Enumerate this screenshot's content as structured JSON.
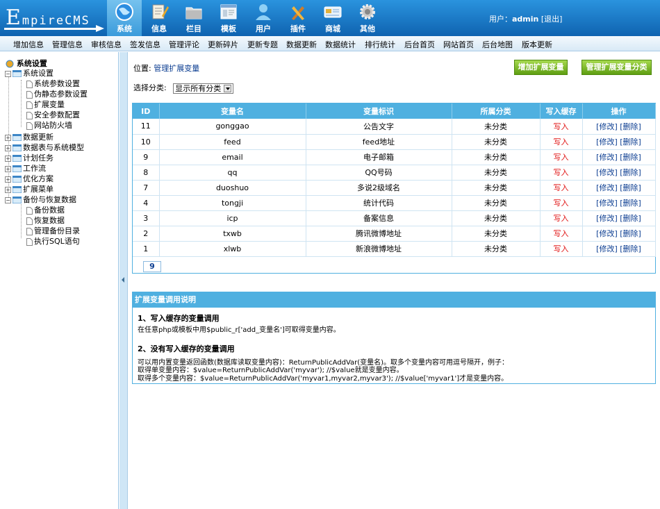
{
  "header": {
    "logo": "EmpireCMS",
    "nav_tabs": [
      {
        "label": "系统",
        "icon": "globe-icon",
        "active": true
      },
      {
        "label": "信息",
        "icon": "notepad-icon"
      },
      {
        "label": "栏目",
        "icon": "folder-icon"
      },
      {
        "label": "模板",
        "icon": "window-icon"
      },
      {
        "label": "用户",
        "icon": "user-icon"
      },
      {
        "label": "插件",
        "icon": "tools-icon"
      },
      {
        "label": "商城",
        "icon": "card-icon"
      },
      {
        "label": "其他",
        "icon": "gear-icon"
      }
    ],
    "user_prefix": "用户：",
    "user_name": "admin",
    "logout": "[退出]"
  },
  "subnav": [
    "增加信息",
    "管理信息",
    "审核信息",
    "签发信息",
    "管理评论",
    "更新碎片",
    "更新专题",
    "数据更新",
    "数据统计",
    "排行统计",
    "后台首页",
    "网站首页",
    "后台地图",
    "版本更新"
  ],
  "sidebar": {
    "root": "系统设置",
    "groups": [
      {
        "label": "系统设置",
        "expanded": true,
        "children": [
          "系统参数设置",
          "伪静态参数设置",
          "扩展变量",
          "安全参数配置",
          "网站防火墙"
        ]
      },
      {
        "label": "数据更新"
      },
      {
        "label": "数据表与系统模型"
      },
      {
        "label": "计划任务"
      },
      {
        "label": "工作流"
      },
      {
        "label": "优化方案"
      },
      {
        "label": "扩展菜单"
      },
      {
        "label": "备份与恢复数据",
        "expanded": true,
        "children": [
          "备份数据",
          "恢复数据",
          "管理备份目录",
          "执行SQL语句"
        ]
      }
    ]
  },
  "main": {
    "breadcrumb_prefix": "位置: ",
    "breadcrumb_link": "管理扩展变量",
    "btn_add": "增加扩展变量",
    "btn_manage_class": "管理扩展变量分类",
    "filter_label": "选择分类:",
    "filter_value": "显示所有分类",
    "table": {
      "headers": [
        "ID",
        "变量名",
        "变量标识",
        "所属分类",
        "写入缓存",
        "操作"
      ],
      "rows": [
        {
          "id": "11",
          "name": "gonggao",
          "label": "公告文字",
          "cls": "未分类",
          "cache": "写入",
          "edit": "[修改]",
          "del": "[删除]"
        },
        {
          "id": "10",
          "name": "feed",
          "label": "feed地址",
          "cls": "未分类",
          "cache": "写入",
          "edit": "[修改]",
          "del": "[删除]"
        },
        {
          "id": "9",
          "name": "email",
          "label": "电子邮箱",
          "cls": "未分类",
          "cache": "写入",
          "edit": "[修改]",
          "del": "[删除]"
        },
        {
          "id": "8",
          "name": "qq",
          "label": "QQ号码",
          "cls": "未分类",
          "cache": "写入",
          "edit": "[修改]",
          "del": "[删除]"
        },
        {
          "id": "7",
          "name": "duoshuo",
          "label": "多说2级域名",
          "cls": "未分类",
          "cache": "写入",
          "edit": "[修改]",
          "del": "[删除]"
        },
        {
          "id": "4",
          "name": "tongji",
          "label": "统计代码",
          "cls": "未分类",
          "cache": "写入",
          "edit": "[修改]",
          "del": "[删除]"
        },
        {
          "id": "3",
          "name": "icp",
          "label": "备案信息",
          "cls": "未分类",
          "cache": "写入",
          "edit": "[修改]",
          "del": "[删除]"
        },
        {
          "id": "2",
          "name": "txwb",
          "label": "腾讯微博地址",
          "cls": "未分类",
          "cache": "写入",
          "edit": "[修改]",
          "del": "[删除]"
        },
        {
          "id": "1",
          "name": "xlwb",
          "label": "新浪微博地址",
          "cls": "未分类",
          "cache": "写入",
          "edit": "[修改]",
          "del": "[删除]"
        }
      ],
      "pager": "9"
    },
    "notes": {
      "title": "扩展变量调用说明",
      "h1": "1、写入缓存的变量调用",
      "p1": "在任意php或模板中用$public_r['add_变量名']可取得变量内容。",
      "h2": "2、没有写入缓存的变量调用",
      "p2a": "可以用内置变量返回函数(数据库读取变量内容)：ReturnPublicAddVar(变量名)。取多个变量内容可用逗号隔开，例子：",
      "p2b": "取得单变量内容：$value=ReturnPublicAddVar('myvar'); //$value就是变量内容。",
      "p2c": "取得多个变量内容：$value=ReturnPublicAddVar('myvar1,myvar2,myvar3'); //$value['myvar1']才是变量内容。"
    }
  },
  "colors": {
    "header_blue": "#1e7bc9",
    "table_head": "#4fb0e0",
    "button_green": "#7dbb2a",
    "write_red": "#e01010",
    "link_blue": "#0b3d91"
  }
}
